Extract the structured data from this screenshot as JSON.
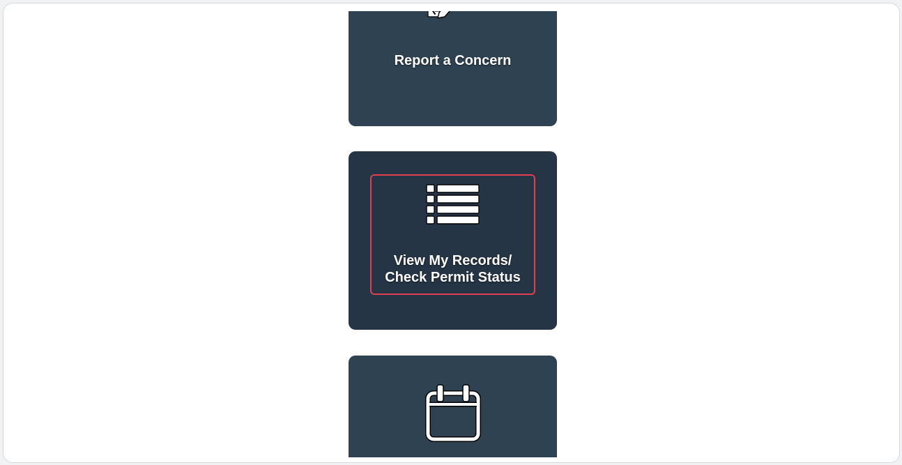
{
  "tiles": {
    "report": {
      "label": "Report a Concern",
      "icon": "pencil-square-icon"
    },
    "records": {
      "label_line1": "View My Records/",
      "label_line2": "Check Permit Status",
      "icon": "list-icon",
      "highlighted": true
    },
    "schedule": {
      "icon": "calendar-icon"
    }
  },
  "colors": {
    "tile_background": "#2e4251",
    "tile_background_active": "#253545",
    "highlight_border": "#e0404f",
    "text": "#ffffff"
  }
}
